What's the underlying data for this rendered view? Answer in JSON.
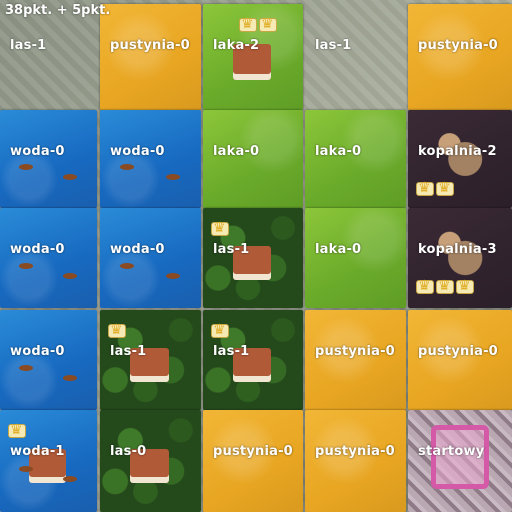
{
  "score_text": "38pkt. + 5pkt.",
  "grid": [
    [
      {
        "label": "las-1",
        "terrain": "empty",
        "crowns": 0
      },
      {
        "label": "pustynia-0",
        "terrain": "pustynia",
        "crowns": 0
      },
      {
        "label": "laka-2",
        "terrain": "laka",
        "crowns": 2
      },
      {
        "label": "las-1",
        "terrain": "empty",
        "crowns": 0
      },
      {
        "label": "pustynia-0",
        "terrain": "pustynia",
        "crowns": 0
      }
    ],
    [
      {
        "label": "woda-0",
        "terrain": "woda",
        "crowns": 0
      },
      {
        "label": "woda-0",
        "terrain": "woda",
        "crowns": 0
      },
      {
        "label": "laka-0",
        "terrain": "laka",
        "crowns": 0
      },
      {
        "label": "laka-0",
        "terrain": "laka",
        "crowns": 0
      },
      {
        "label": "kopalnia-2",
        "terrain": "kopalnia",
        "crowns": 2
      }
    ],
    [
      {
        "label": "woda-0",
        "terrain": "woda",
        "crowns": 0
      },
      {
        "label": "woda-0",
        "terrain": "woda",
        "crowns": 0
      },
      {
        "label": "las-1",
        "terrain": "las",
        "crowns": 1
      },
      {
        "label": "laka-0",
        "terrain": "laka",
        "crowns": 0
      },
      {
        "label": "kopalnia-3",
        "terrain": "kopalnia",
        "crowns": 3
      }
    ],
    [
      {
        "label": "woda-0",
        "terrain": "woda",
        "crowns": 0
      },
      {
        "label": "las-1",
        "terrain": "las",
        "crowns": 1
      },
      {
        "label": "las-1",
        "terrain": "las",
        "crowns": 1
      },
      {
        "label": "pustynia-0",
        "terrain": "pustynia",
        "crowns": 0
      },
      {
        "label": "pustynia-0",
        "terrain": "pustynia",
        "crowns": 0
      }
    ],
    [
      {
        "label": "woda-1",
        "terrain": "woda",
        "crowns": 1
      },
      {
        "label": "las-0",
        "terrain": "las",
        "crowns": 0
      },
      {
        "label": "pustynia-0",
        "terrain": "pustynia",
        "crowns": 0
      },
      {
        "label": "pustynia-0",
        "terrain": "pustynia",
        "crowns": 0
      },
      {
        "label": "startowy",
        "terrain": "startowy",
        "crowns": 0
      }
    ]
  ]
}
